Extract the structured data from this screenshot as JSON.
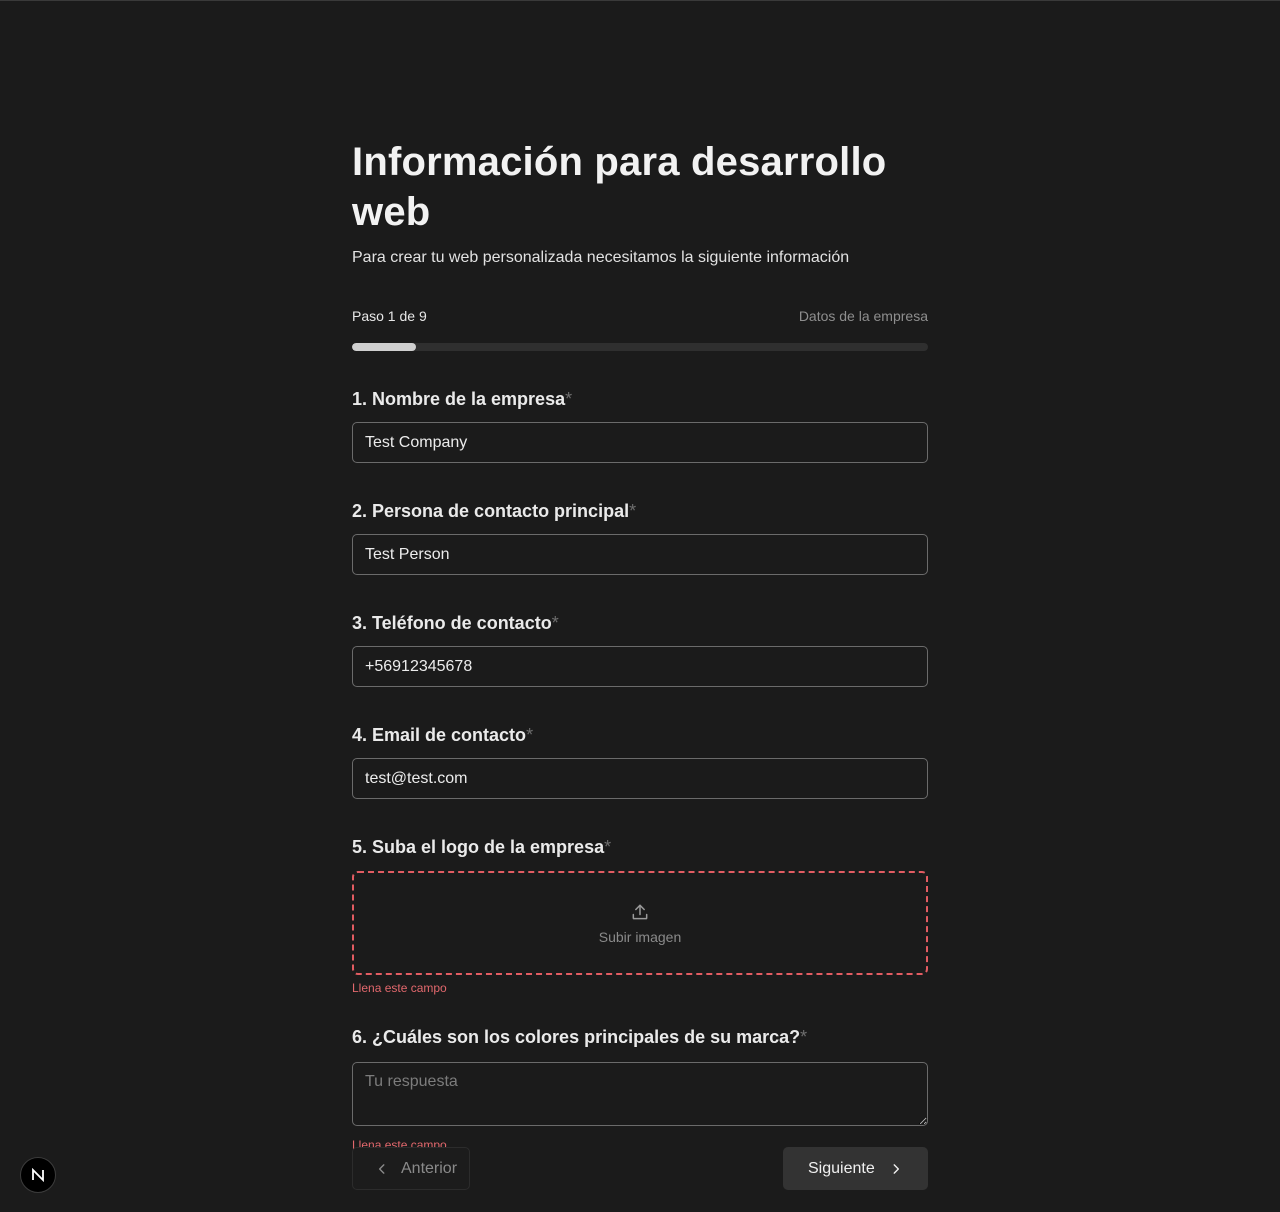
{
  "header": {
    "title": "Información para desarrollo web",
    "subtitle": "Para crear tu web personalizada necesitamos la siguiente información"
  },
  "progress": {
    "step_label": "Paso 1 de 9",
    "section_name": "Datos de la empresa",
    "current": 1,
    "total": 9
  },
  "fields": [
    {
      "label": "1. Nombre de la empresa",
      "required_mark": "*",
      "value": "Test Company"
    },
    {
      "label": "2. Persona de contacto principal",
      "required_mark": "*",
      "value": "Test Person"
    },
    {
      "label": "3. Teléfono de contacto",
      "required_mark": "*",
      "value": "+56912345678"
    },
    {
      "label": "4. Email de contacto",
      "required_mark": "*",
      "value": "test@test.com"
    },
    {
      "label": "5. Suba el logo de la empresa",
      "required_mark": "*",
      "upload_text": "Subir imagen",
      "error": "Llena este campo",
      "icon": "upload-icon"
    },
    {
      "label": "6. ¿Cuáles son los colores principales de su marca?",
      "required_mark": "*",
      "placeholder": "Tu respuesta",
      "value": "",
      "error": "Llena este campo"
    }
  ],
  "navigation": {
    "prev_label": "Anterior",
    "next_label": "Siguiente",
    "prev_icon": "chevron-left-icon",
    "next_icon": "chevron-right-icon"
  },
  "badge": {
    "icon": "n-logo-icon"
  },
  "colors": {
    "background": "#1b1b1b",
    "error": "#e2686d",
    "upload_border": "#e25c62",
    "progress_fill": "#cfcfcf",
    "progress_track": "#2f2f2f"
  }
}
